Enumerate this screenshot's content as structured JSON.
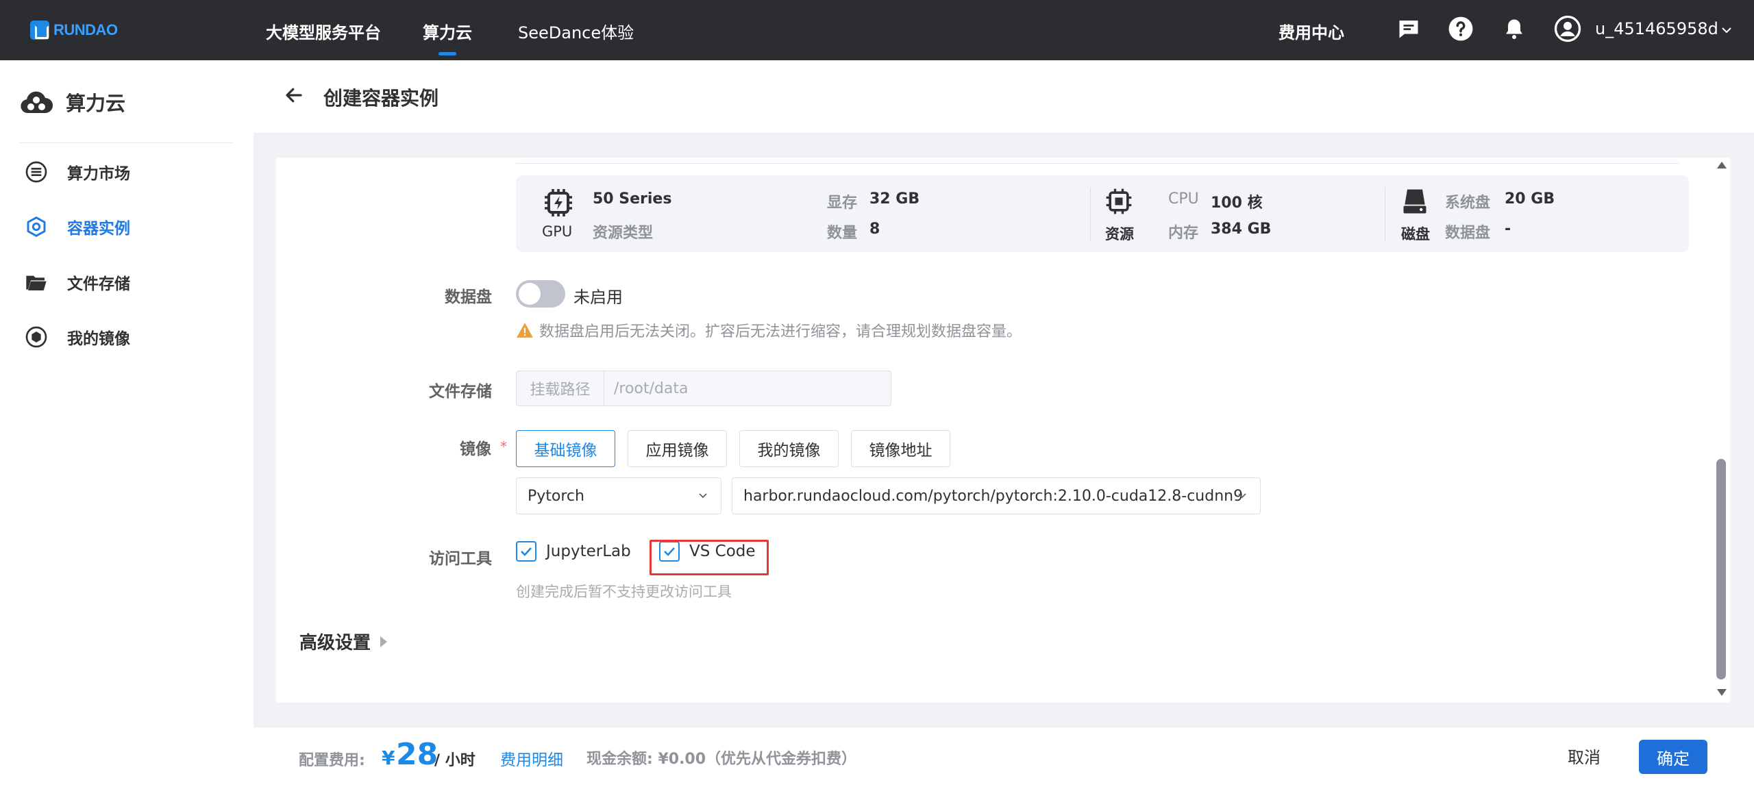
{
  "colors": {
    "accent": "#1e88e5",
    "topbar": "#2b2d31",
    "highlight": "#e53935"
  },
  "topbar": {
    "logo_text": "RUNDAO",
    "nav": [
      {
        "label": "大模型服务平台"
      },
      {
        "label": "算力云",
        "active": true
      },
      {
        "label": "SeeDance体验"
      }
    ],
    "billing_center": "费用中心",
    "icons": [
      "message-icon",
      "help-icon",
      "bell-icon",
      "user-avatar-icon"
    ],
    "username": "u_451465958d"
  },
  "sidebar": {
    "title": "算力云",
    "items": [
      {
        "label": "算力市场",
        "icon": "market-icon"
      },
      {
        "label": "容器实例",
        "icon": "container-icon",
        "active": true
      },
      {
        "label": "文件存储",
        "icon": "folder-icon"
      },
      {
        "label": "我的镜像",
        "icon": "image-icon"
      }
    ]
  },
  "page": {
    "title": "创建容器实例"
  },
  "resources": {
    "gpu": {
      "icon_label": "GPU",
      "series": "50 Series",
      "type_label": "资源类型",
      "vram_label": "显存",
      "vram_value": "32 GB",
      "count_label": "数量",
      "count_value": "8"
    },
    "compute": {
      "icon_label": "资源",
      "cpu_label": "CPU",
      "cpu_value": "100 核",
      "mem_label": "内存",
      "mem_value": "384 GB"
    },
    "disk": {
      "icon_label": "磁盘",
      "sys_label": "系统盘",
      "sys_value": "20 GB",
      "data_label": "数据盘",
      "data_value": "-"
    }
  },
  "form": {
    "data_disk": {
      "label": "数据盘",
      "toggle_state": "未启用",
      "enabled": false,
      "warning": "数据盘启用后无法关闭。扩容后无法进行缩容，请合理规划数据盘容量。"
    },
    "file_storage": {
      "label": "文件存储",
      "prefix": "挂载路径",
      "value": "/root/data"
    },
    "image": {
      "label": "镜像",
      "required_mark": "*",
      "tabs": [
        "基础镜像",
        "应用镜像",
        "我的镜像",
        "镜像地址"
      ],
      "active_tab": "基础镜像",
      "framework": "Pytorch",
      "address": "harbor.rundaocloud.com/pytorch/pytorch:2.10.0-cuda12.8-cudnn9"
    },
    "access_tools": {
      "label": "访问工具",
      "options": [
        {
          "label": "JupyterLab",
          "checked": true
        },
        {
          "label": "VS Code",
          "checked": true
        }
      ],
      "hint": "创建完成后暂不支持更改访问工具"
    },
    "advanced": "高级设置"
  },
  "footer": {
    "fee_label": "配置费用:",
    "currency": "¥",
    "amount": "28",
    "unit": "/ 小时",
    "fee_detail": "费用明细",
    "balance": "现金余额: ¥0.00（优先从代金券扣费）",
    "cancel": "取消",
    "confirm": "确定"
  }
}
